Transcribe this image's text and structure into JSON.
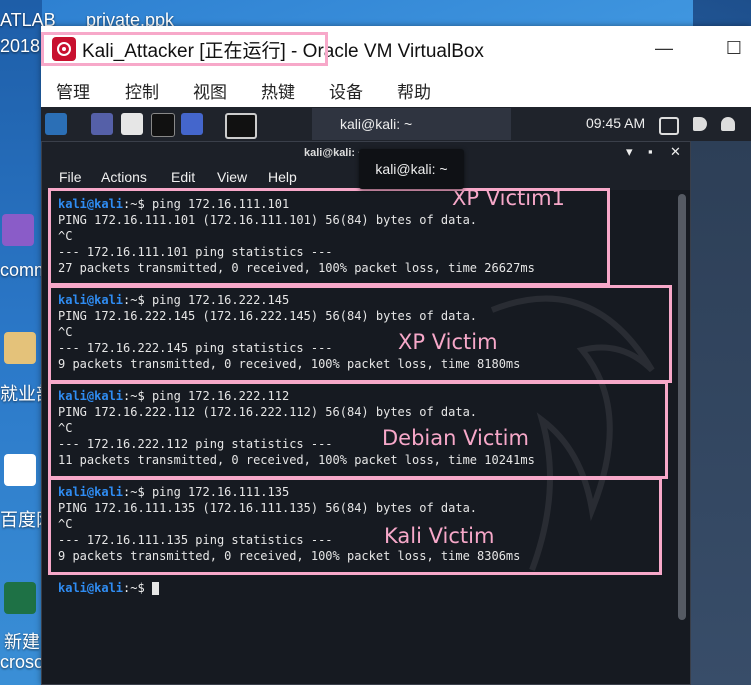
{
  "desktop": {
    "labels": [
      "ATLAB",
      "private.ppk",
      "2018",
      "comm",
      "就业部",
      "百度网",
      "新建",
      "croso"
    ]
  },
  "vbox": {
    "title": "Kali_Attacker [正在运行] - Oracle VM VirtualBox",
    "menu": [
      "管理",
      "控制",
      "视图",
      "热键",
      "设备",
      "帮助"
    ],
    "minimize": "—",
    "maximize": "☐"
  },
  "kali_panel": {
    "task_label": "kali@kali: ~",
    "clock": "09:45 AM"
  },
  "terminal": {
    "title": "kali@kali: ~",
    "tooltip": "kali@kali: ~",
    "menu": [
      "File",
      "Actions",
      "Edit",
      "View",
      "Help"
    ],
    "prompt_user": "kali@kali",
    "prompt_path": ":~$ ",
    "blocks": [
      {
        "command": "ping 172.16.111.101",
        "lines": [
          "PING 172.16.111.101 (172.16.111.101) 56(84) bytes of data.",
          "^C",
          "--- 172.16.111.101 ping statistics ---",
          "27 packets transmitted, 0 received, 100% packet loss, time 26627ms"
        ],
        "annotation": "XP Victim1"
      },
      {
        "command": "ping 172.16.222.145",
        "lines": [
          "PING 172.16.222.145 (172.16.222.145) 56(84) bytes of data.",
          "^C",
          "--- 172.16.222.145 ping statistics ---",
          "9 packets transmitted, 0 received, 100% packet loss, time 8180ms"
        ],
        "annotation": "XP Victim"
      },
      {
        "command": "ping 172.16.222.112",
        "lines": [
          "PING 172.16.222.112 (172.16.222.112) 56(84) bytes of data.",
          "^C",
          "--- 172.16.222.112 ping statistics ---",
          "11 packets transmitted, 0 received, 100% packet loss, time 10241ms"
        ],
        "annotation": "Debian Victim"
      },
      {
        "command": "ping 172.16.111.135",
        "lines": [
          "PING 172.16.111.135 (172.16.111.135) 56(84) bytes of data.",
          "^C",
          "--- 172.16.111.135 ping statistics ---",
          "9 packets transmitted, 0 received, 100% packet loss, time 8306ms"
        ],
        "annotation": "Kali Victim"
      }
    ]
  },
  "colors": {
    "highlight": "#f7a8c9",
    "prompt_user": "#2f8cf2",
    "terminal_bg": "#161a21"
  }
}
